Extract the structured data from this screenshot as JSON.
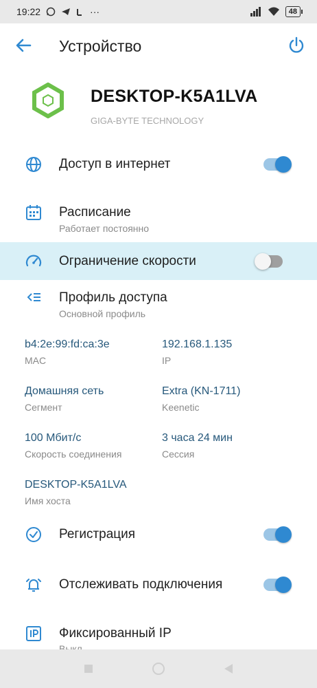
{
  "status_bar": {
    "time": "19:22",
    "dots": "···",
    "signal_text": "...",
    "battery": "48"
  },
  "appbar": {
    "title": "Устройство"
  },
  "device": {
    "name": "DESKTOP-K5A1LVA",
    "vendor": "GIGA-BYTE TECHNOLOGY"
  },
  "settings": {
    "internet": {
      "label": "Доступ в интернет",
      "enabled": true
    },
    "schedule": {
      "label": "Расписание",
      "sub": "Работает постоянно"
    },
    "speed_limit": {
      "label": "Ограничение скорости",
      "enabled": false
    },
    "access_profile": {
      "label": "Профиль доступа",
      "sub": "Основной профиль"
    },
    "registration": {
      "label": "Регистрация",
      "enabled": true
    },
    "track": {
      "label": "Отслеживать подключения",
      "enabled": true
    },
    "fixed_ip": {
      "label": "Фиксированный IP",
      "sub": "Выкл."
    }
  },
  "info": {
    "mac": {
      "value": "b4:2e:99:fd:ca:3e",
      "caption": "MAC"
    },
    "ip": {
      "value": "192.168.1.135",
      "caption": "IP"
    },
    "segment": {
      "value": "Домашняя сеть",
      "caption": "Сегмент"
    },
    "keenetic": {
      "value": "Extra (KN-1711)",
      "caption": "Keenetic"
    },
    "speed": {
      "value": "100 Мбит/с",
      "caption": "Скорость соединения"
    },
    "session": {
      "value": "3 часа 24 мин",
      "caption": "Сессия"
    },
    "hostname": {
      "value": "DESKTOP-K5A1LVA",
      "caption": "Имя хоста"
    }
  },
  "colors": {
    "accent": "#2f89d1",
    "highlight": "#d9f0f7",
    "device_icon": "#6cc04a",
    "value_text": "#26587b"
  }
}
